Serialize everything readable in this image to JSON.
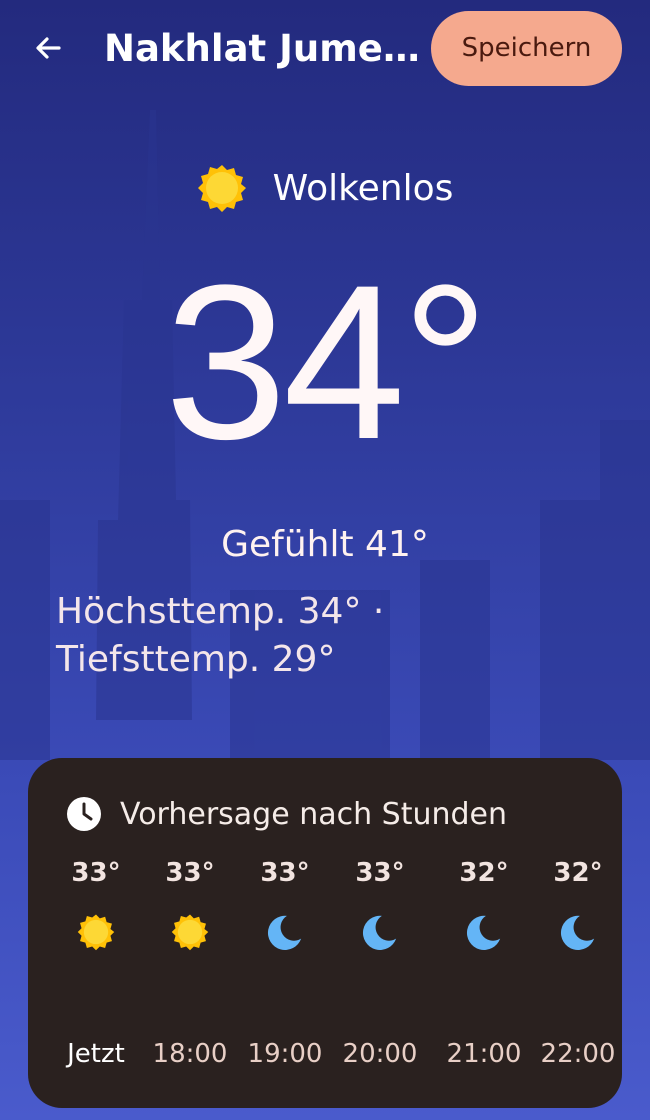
{
  "header": {
    "location": "Nakhlat Jumeir...",
    "save_label": "Speichern"
  },
  "current": {
    "condition": "Wolkenlos",
    "condition_icon": "sun-icon",
    "temperature": "34°",
    "feels_like": "Gefühlt 41°",
    "high": "Höchsttemp. 34° ·",
    "low": "Tiefsttemp. 29°"
  },
  "hourly": {
    "title": "Vorhersage nach Stunden",
    "icon": "clock-icon",
    "items": [
      {
        "temp": "33°",
        "icon": "sun-icon",
        "time": "Jetzt"
      },
      {
        "temp": "33°",
        "icon": "sun-icon",
        "time": "18:00"
      },
      {
        "temp": "33°",
        "icon": "moon-icon",
        "time": "19:00"
      },
      {
        "temp": "33°",
        "icon": "moon-icon",
        "time": "20:00"
      },
      {
        "temp": "32°",
        "icon": "moon-icon",
        "time": "21:00"
      },
      {
        "temp": "32°",
        "icon": "moon-icon",
        "time": "22:00"
      }
    ]
  },
  "colors": {
    "save_button_bg": "#f5a98e",
    "card_bg": "#2a211f",
    "sun": "#ffc107",
    "moon": "#64b5f6"
  }
}
